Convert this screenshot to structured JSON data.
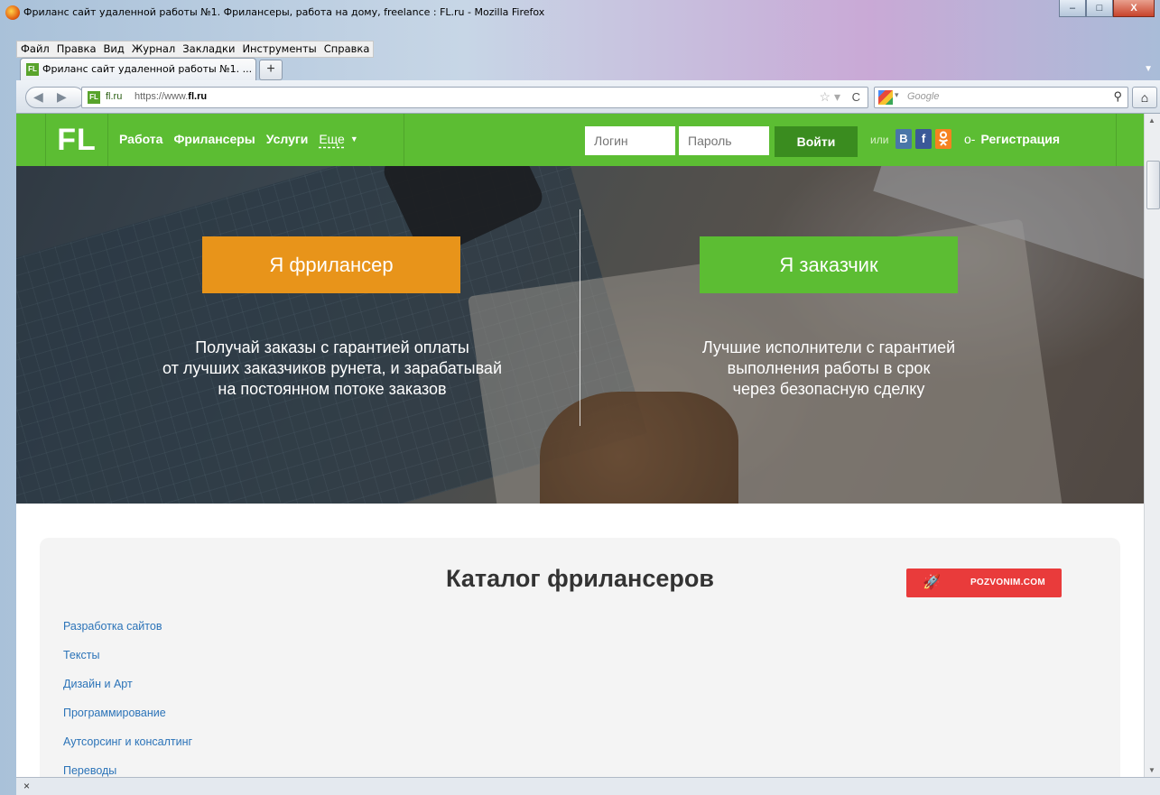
{
  "window": {
    "title": "Фриланс сайт удаленной работы №1. Фрилансеры, работа на дому, freelance : FL.ru - Mozilla Firefox"
  },
  "menu": [
    "Файл",
    "Правка",
    "Вид",
    "Журнал",
    "Закладки",
    "Инструменты",
    "Справка"
  ],
  "tab": {
    "favicon": "FL",
    "label": "Фриланс сайт удаленной работы №1. ...",
    "new_tab": "+"
  },
  "navbar": {
    "domain": "fl.ru",
    "url_prefix": "https://www.",
    "url_host": "fl.ru",
    "search_placeholder": "Google"
  },
  "site": {
    "logo": "FL",
    "nav": [
      "Работа",
      "Фрилансеры",
      "Услуги",
      "Еще"
    ],
    "login_placeholder": "Логин",
    "password_placeholder": "Пароль",
    "login_button": "Войти",
    "or": "или",
    "social": {
      "vk": "В",
      "fb": "f",
      "ok": "ok-icon"
    },
    "register": "Регистрация"
  },
  "hero": {
    "freelancer_button": "Я фрилансер",
    "customer_button": "Я заказчик",
    "freelancer_text": [
      "Получай заказы с гарантией оплаты",
      "от лучших заказчиков рунета, и зарабатывай",
      "на постоянном потоке заказов"
    ],
    "customer_text": [
      "Лучшие исполнители с гарантией",
      "выполнения работы в срок",
      "через безопасную сделку"
    ]
  },
  "catalog": {
    "title": "Каталог фрилансеров",
    "badge": "POZVONIM.COM",
    "items": [
      "Разработка сайтов",
      "Тексты",
      "Дизайн и Арт",
      "Программирование",
      "Аутсорсинг и консалтинг",
      "Переводы"
    ]
  },
  "colors": {
    "brand_green": "#5cbd33",
    "freelancer_orange": "#e8941a",
    "link_blue": "#2b73b8"
  }
}
